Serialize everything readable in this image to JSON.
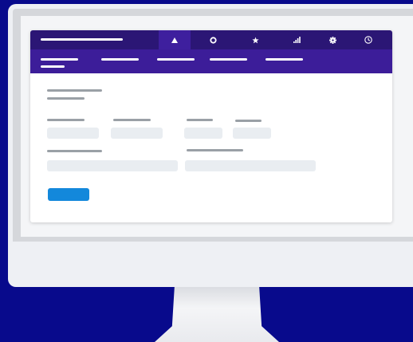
{
  "colors": {
    "background": "#080a8c",
    "header": "#2b1675",
    "header_active_tab": "#3e1f9e",
    "subnav": "#3c1d99",
    "field": "#e9edf1",
    "placeholder_text_line": "#9aa0a6",
    "primary_button": "#1388db"
  },
  "header": {
    "tabs": [
      {
        "icon": "triangle-icon",
        "active": true
      },
      {
        "icon": "circle-icon",
        "active": false
      },
      {
        "icon": "star-icon",
        "active": false
      },
      {
        "icon": "signal-bars-icon",
        "active": false
      },
      {
        "icon": "gear-icon",
        "active": false
      },
      {
        "icon": "clock-icon",
        "active": false
      }
    ]
  },
  "subnav": {
    "item_count": 5,
    "active_index": 0
  },
  "form": {
    "field_count": 6,
    "button": {
      "icon": "none"
    }
  }
}
